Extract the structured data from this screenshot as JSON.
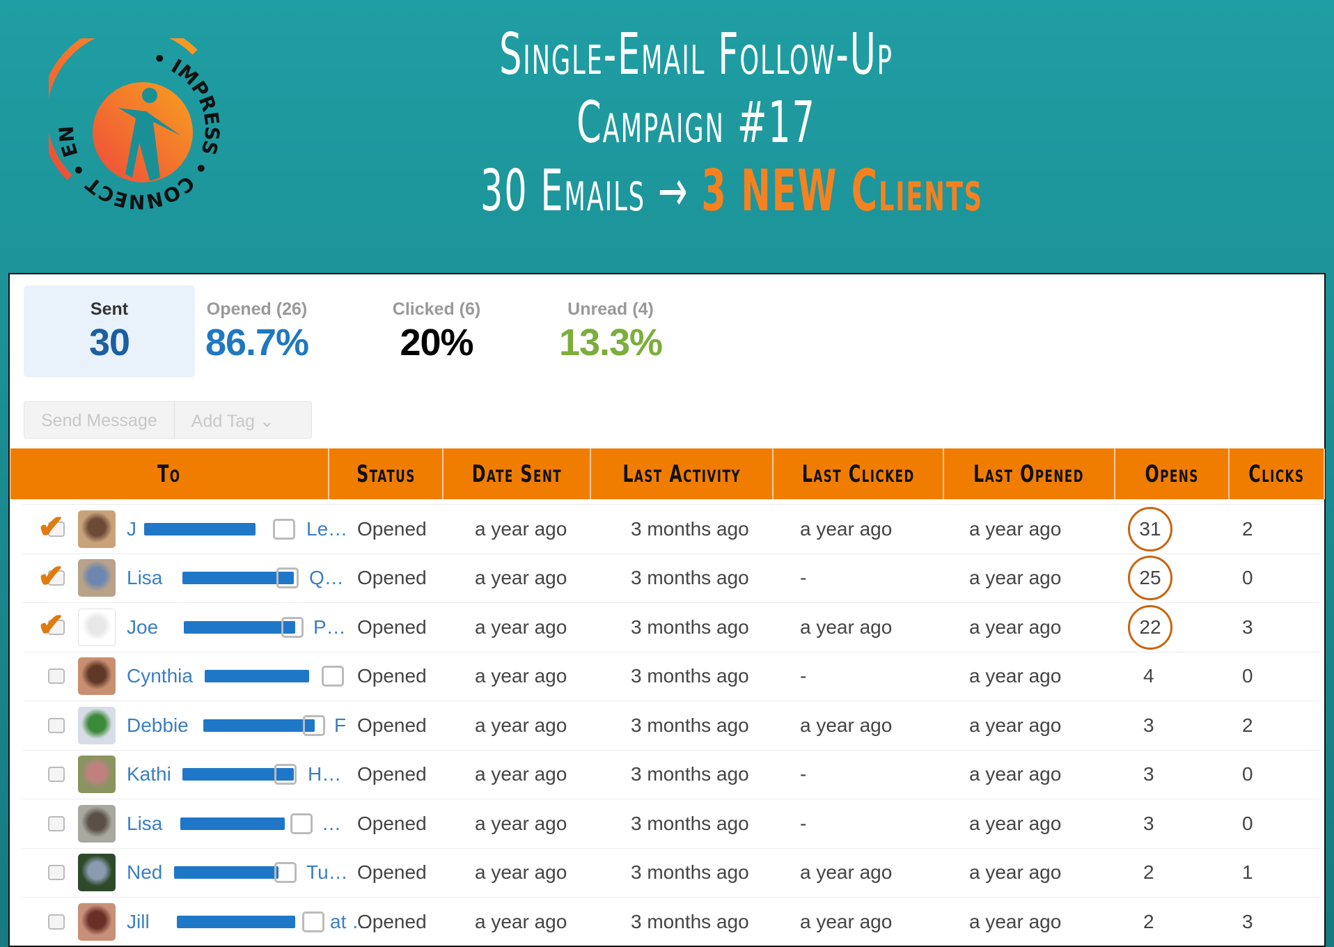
{
  "header": {
    "line1": "Single-Email Follow-Up",
    "line2": "Campaign #17",
    "line3_prefix": "30 Emails → ",
    "line3_highlight": "3 NEW Clients"
  },
  "logo": {
    "text": "IMPRESS • CONNECT • ENGAGE •",
    "colors": {
      "orange": "#f5821f",
      "red": "#ef4a3a"
    }
  },
  "stats": [
    {
      "label": "Sent",
      "value": "30",
      "color": "#1a5fa0"
    },
    {
      "label": "Opened (26)",
      "value": "86.7%",
      "color": "#1f78c0"
    },
    {
      "label": "Clicked (6)",
      "value": "20%",
      "color": "#000000"
    },
    {
      "label": "Unread (4)",
      "value": "13.3%",
      "color": "#7bae3a"
    }
  ],
  "toolbar": {
    "send_message": "Send Message",
    "add_tag": "Add Tag",
    "chevron": "chevron-down-icon"
  },
  "columns": [
    "To",
    "Status",
    "Date Sent",
    "Last Activity",
    "Last Clicked",
    "Last Opened",
    "Opens",
    "Clicks"
  ],
  "accent": "#f07d00",
  "rows": [
    {
      "checked": true,
      "name": "J",
      "suffix": "Le…",
      "status": "Opened",
      "date_sent": "a year ago",
      "last_activity": "3 months ago",
      "last_clicked": "a year ago",
      "last_opened": "a year ago",
      "opens": "31",
      "clicks": "2",
      "highlight": true
    },
    {
      "checked": true,
      "name": "Lisa",
      "suffix": "Q…",
      "status": "Opened",
      "date_sent": "a year ago",
      "last_activity": "3 months ago",
      "last_clicked": "-",
      "last_opened": "a year ago",
      "opens": "25",
      "clicks": "0",
      "highlight": true
    },
    {
      "checked": true,
      "name": "Joe",
      "suffix": "P…",
      "status": "Opened",
      "date_sent": "a year ago",
      "last_activity": "3 months ago",
      "last_clicked": "a year ago",
      "last_opened": "a year ago",
      "opens": "22",
      "clicks": "3",
      "highlight": true
    },
    {
      "checked": false,
      "name": "Cynthia",
      "suffix": "",
      "status": "Opened",
      "date_sent": "a year ago",
      "last_activity": "3 months ago",
      "last_clicked": "-",
      "last_opened": "a year ago",
      "opens": "4",
      "clicks": "0"
    },
    {
      "checked": false,
      "name": "Debbie",
      "suffix": "F",
      "status": "Opened",
      "date_sent": "a year ago",
      "last_activity": "3 months ago",
      "last_clicked": "a year ago",
      "last_opened": "a year ago",
      "opens": "3",
      "clicks": "2"
    },
    {
      "checked": false,
      "name": "Kathi",
      "suffix": "H…",
      "status": "Opened",
      "date_sent": "a year ago",
      "last_activity": "3 months ago",
      "last_clicked": "-",
      "last_opened": "a year ago",
      "opens": "3",
      "clicks": "0"
    },
    {
      "checked": false,
      "name": "Lisa",
      "suffix": "…",
      "status": "Opened",
      "date_sent": "a year ago",
      "last_activity": "3 months ago",
      "last_clicked": "-",
      "last_opened": "a year ago",
      "opens": "3",
      "clicks": "0"
    },
    {
      "checked": false,
      "name": "Ned",
      "suffix": "Tu…",
      "status": "Opened",
      "date_sent": "a year ago",
      "last_activity": "3 months ago",
      "last_clicked": "a year ago",
      "last_opened": "a year ago",
      "opens": "2",
      "clicks": "1"
    },
    {
      "checked": false,
      "name": "Jill",
      "suffix": "at …",
      "status": "Opened",
      "date_sent": "a year ago",
      "last_activity": "3 months ago",
      "last_clicked": "a year ago",
      "last_opened": "a year ago",
      "opens": "2",
      "clicks": "3"
    }
  ]
}
